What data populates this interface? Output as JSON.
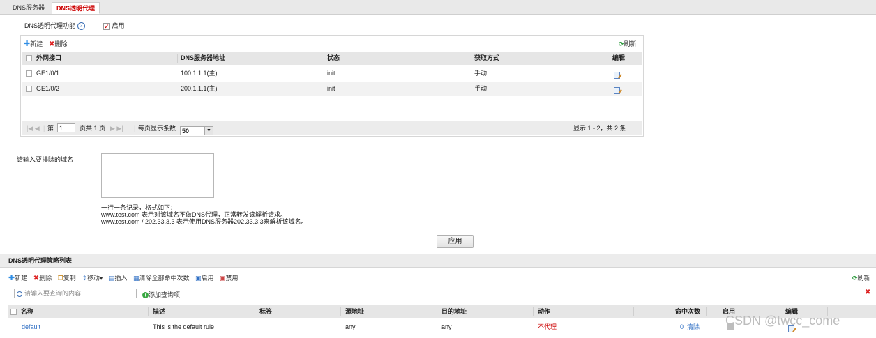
{
  "tabs": [
    {
      "label": "DNS服务器"
    },
    {
      "label": "DNS透明代理"
    }
  ],
  "feature": {
    "label": "DNS透明代理功能",
    "help": "?",
    "enable_label": "启用",
    "enabled": true
  },
  "upper_toolbar": {
    "new": "新建",
    "delete": "删除",
    "refresh": "刷新"
  },
  "upper_table": {
    "headers": [
      "外网接口",
      "DNS服务器地址",
      "状态",
      "获取方式",
      "编辑"
    ],
    "rows": [
      {
        "iface": "GE1/0/1",
        "dns": "100.1.1.1(主)",
        "status": "init",
        "method": "手动"
      },
      {
        "iface": "GE1/0/2",
        "dns": "200.1.1.1(主)",
        "status": "init",
        "method": "手动"
      }
    ]
  },
  "pager": {
    "page_prefix": "第",
    "page_value": "1",
    "page_total": "页共 1 页",
    "per_page_label": "每页显示条数",
    "per_page_value": "50",
    "display_info": "显示 1 - 2，共 2 条"
  },
  "exclude": {
    "label": "请输入要排除的域名",
    "help_lines": [
      "一行一条记录，格式如下：",
      "www.test.com 表示对该域名不做DNS代理，正常转发该解析请求。",
      "www.test.com / 202.33.3.3 表示使用DNS服务器202.33.3.3来解析该域名。"
    ]
  },
  "apply_button": "应用",
  "policy_section": {
    "title": "DNS透明代理策略列表"
  },
  "policy_toolbar": {
    "new": "新建",
    "delete": "删除",
    "copy": "复制",
    "move": "移动",
    "insert": "插入",
    "clear_hits": "清除全部命中次数",
    "enable": "启用",
    "disable": "禁用",
    "refresh": "刷新"
  },
  "search": {
    "placeholder": "请输入要查询的内容",
    "add_condition": "添加查询项"
  },
  "policy_table": {
    "headers": [
      "名称",
      "描述",
      "标签",
      "源地址",
      "目的地址",
      "动作",
      "命中次数",
      "启用",
      "编辑"
    ],
    "rows": [
      {
        "name": "default",
        "desc": "This is the default rule",
        "tag": "",
        "src": "any",
        "dst": "any",
        "action": "不代理",
        "hits": "0",
        "clear": "清除"
      }
    ]
  },
  "watermark": "CSDN @twcc_come",
  "colors": {
    "accent_red": "#cc0000",
    "link_blue": "#2f6fc4",
    "refresh_green": "#2b9a3c"
  }
}
